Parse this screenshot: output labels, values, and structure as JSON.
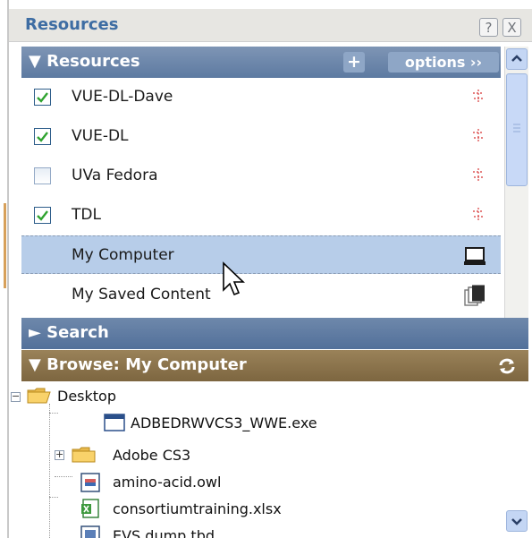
{
  "window": {
    "title": "Resources",
    "help_label": "?",
    "close_label": "X"
  },
  "resources_panel": {
    "header": "▼ Resources",
    "add_label": "+",
    "options_label": "options ››",
    "items": [
      {
        "label": "VUE-DL-Dave",
        "checked": true,
        "icon": "network-icon"
      },
      {
        "label": "VUE-DL",
        "checked": true,
        "icon": "network-icon"
      },
      {
        "label": "UVa Fedora",
        "checked": false,
        "icon": "network-icon"
      },
      {
        "label": "TDL",
        "checked": true,
        "icon": "network-icon"
      },
      {
        "label": "My Computer",
        "checked": null,
        "icon": "computer-icon",
        "selected": true
      },
      {
        "label": "My Saved Content",
        "checked": null,
        "icon": "saved-content-icon"
      }
    ]
  },
  "search_panel": {
    "header": "► Search"
  },
  "browse_panel": {
    "header": "▼ Browse: My Computer",
    "refresh_icon": "refresh-icon",
    "tree": [
      {
        "label": "Desktop",
        "icon": "folder-open-icon",
        "expander": "-"
      },
      {
        "label": "ADBEDRWVCS3_WWE.exe",
        "icon": "exe-icon"
      },
      {
        "label": "Adobe CS3",
        "icon": "folder-icon",
        "expander": "+"
      },
      {
        "label": "amino-acid.owl",
        "icon": "file-icon"
      },
      {
        "label": "consortiumtraining.xlsx",
        "icon": "excel-icon"
      },
      {
        "label": "EVS.dump.tbd",
        "icon": "file-icon"
      }
    ]
  },
  "colors": {
    "title_text": "#3e6da3",
    "resources_header": "#5d7aa1",
    "browse_header": "#7d6640",
    "selection": "#b7cde9"
  }
}
